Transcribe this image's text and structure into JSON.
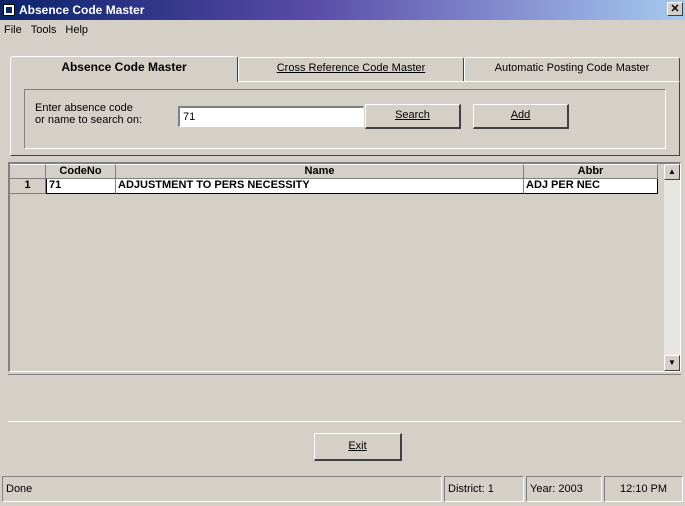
{
  "window": {
    "title": "Absence Code Master",
    "close_glyph": "✕"
  },
  "menu": [
    "File",
    "Tools",
    "Help"
  ],
  "tabs": [
    {
      "label": "Absence Code Master",
      "active": true
    },
    {
      "label": "Cross Reference Code Master",
      "active": false
    },
    {
      "label": "Automatic Posting Code Master",
      "active": false
    }
  ],
  "search": {
    "label_line1": "Enter absence code",
    "label_line2": "or name to search on:",
    "value": "71",
    "search_label": "Search",
    "add_label": "Add"
  },
  "grid": {
    "columns": [
      "",
      "CodeNo",
      "Name",
      "Abbr"
    ],
    "rows": [
      {
        "row_number": "1",
        "code": "71",
        "name": "ADJUSTMENT TO PERS NECESSITY",
        "abbr": "ADJ PER NEC"
      }
    ],
    "scroll_up_glyph": "▲",
    "scroll_down_glyph": "▼"
  },
  "exit_label": "Exit",
  "status": {
    "message": "Done",
    "district": "District: 1",
    "year": "Year: 2003",
    "time": "12:10 PM"
  },
  "colors": {
    "titlebar_start": "#0a246a",
    "titlebar_end": "#a6caf0",
    "face": "#d4d0c8"
  }
}
